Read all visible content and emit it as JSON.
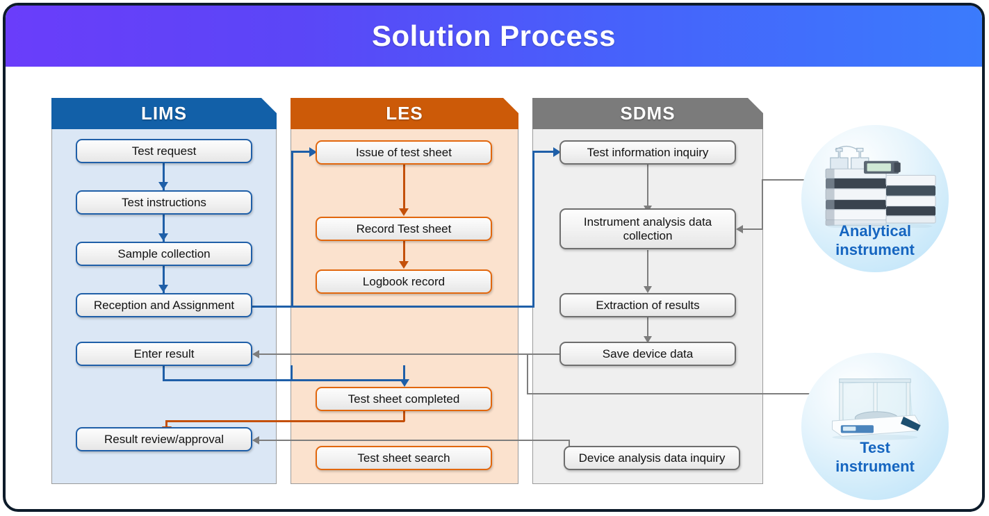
{
  "title": "Solution Process",
  "lanes": [
    {
      "id": "lims",
      "header": "LIMS",
      "accent": "#1260a8",
      "body_bg": "#dbe7f5",
      "nodes": [
        "Test request",
        "Test instructions",
        "Sample collection",
        "Reception and Assignment",
        "Enter result",
        "Result review/approval"
      ]
    },
    {
      "id": "les",
      "header": "LES",
      "accent": "#cc5a08",
      "body_bg": "#fbe2ce",
      "nodes": [
        "Issue of test sheet",
        "Record Test sheet",
        "Logbook record",
        "Test sheet completed",
        "Test sheet search"
      ]
    },
    {
      "id": "sdms",
      "header": "SDMS",
      "accent": "#7b7b7b",
      "body_bg": "#efefef",
      "nodes": [
        "Test information inquiry",
        "Instrument analysis data collection",
        "Extraction of results",
        "Save device data",
        "Device analysis data inquiry"
      ]
    }
  ],
  "instruments": [
    {
      "id": "analytical",
      "label_line1": "Analytical",
      "label_line2": "instrument",
      "art": "hplc-stack-icon"
    },
    {
      "id": "test",
      "label_line1": "Test",
      "label_line2": "instrument",
      "art": "analytical-balance-icon"
    }
  ],
  "colors": {
    "title_gradient_start": "#6a3dfa",
    "title_gradient_end": "#3b7bfc",
    "lims_blue": "#1260a8",
    "les_orange": "#cc5a08",
    "sdms_gray": "#7b7b7b",
    "connector_blue": "#1f5fa8",
    "connector_orange": "#c4500a",
    "connector_gray": "#7d7d7d",
    "instrument_label": "#1565c0",
    "frame_border": "#0d1b2a"
  }
}
